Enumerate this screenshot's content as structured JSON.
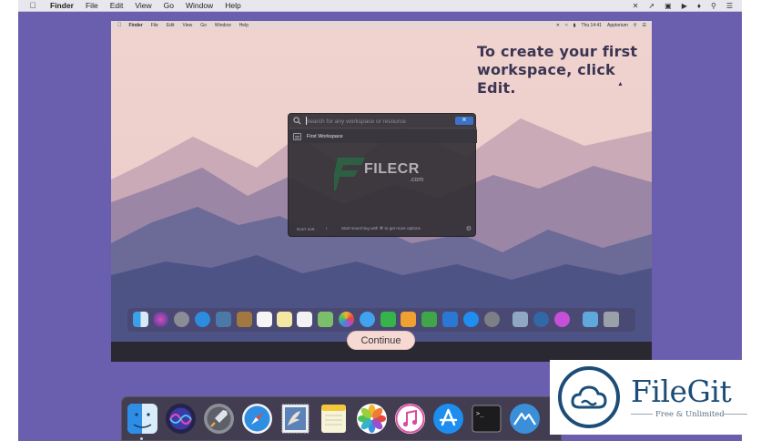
{
  "menubar": {
    "app_name": "Finder",
    "items": [
      "File",
      "Edit",
      "View",
      "Go",
      "Window",
      "Help"
    ]
  },
  "inner_menubar": {
    "app_name": "Finder",
    "items": [
      "File",
      "Edit",
      "View",
      "Go",
      "Window",
      "Help"
    ],
    "clock": "Thu 14:41",
    "user": "Apptorium"
  },
  "hint": {
    "line1": "To create your first",
    "line2": "workspace, click Edit."
  },
  "search": {
    "placeholder": "Search for any workspace or resource",
    "button_label": "⌘"
  },
  "workspace_item": {
    "label": "First Workspace"
  },
  "panel_footer": {
    "sort_label": "Don't sort",
    "sort_caret": "↕",
    "tip": "Start searching with ⌘ to get more options"
  },
  "watermark": {
    "text": "FILECR",
    "sub": ".com"
  },
  "continue_button": {
    "label": "Continue"
  },
  "badge": {
    "name": "FileGit",
    "tagline": "Free & Unlimited"
  },
  "colors": {
    "desktop": "#6a5fae",
    "accent_blue": "#3a73c7",
    "continue_bg": "#f6d9d3"
  }
}
